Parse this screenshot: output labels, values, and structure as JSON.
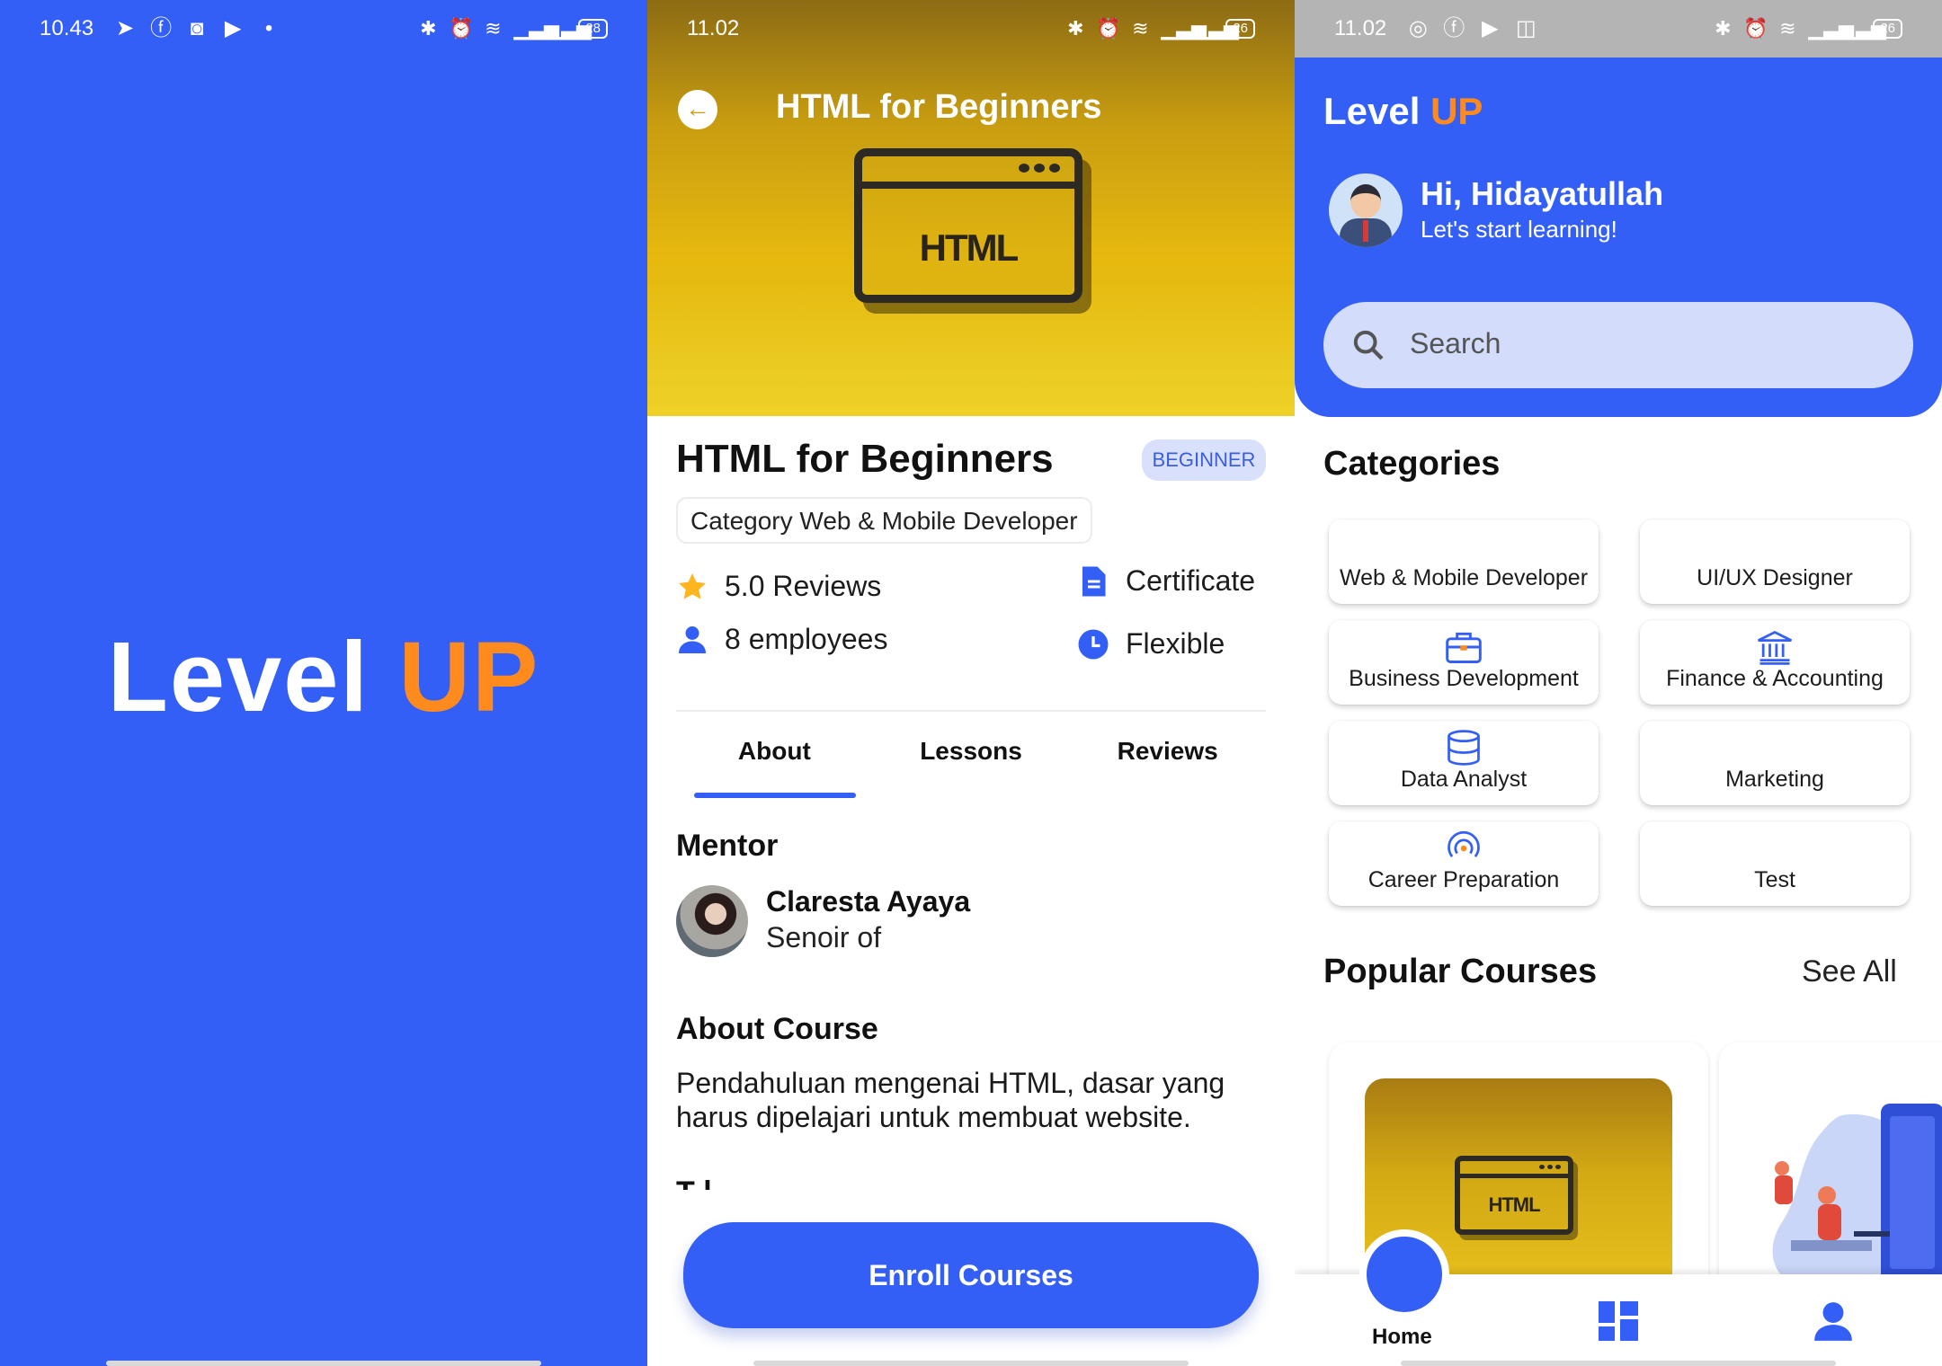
{
  "colors": {
    "primary": "#335ff6",
    "accent": "#ff8a1e",
    "badge_bg": "#d8e0fb",
    "search_bg": "#d3dcfb"
  },
  "splash": {
    "status_time": "10.43",
    "battery": "28",
    "logo_level": "Level",
    "logo_up": "UP"
  },
  "detail": {
    "status_time": "11.02",
    "battery": "26",
    "header_title": "HTML for Beginners",
    "hero_word": "HTML",
    "course_title": "HTML for Beginners",
    "level_badge": "BEGINNER",
    "category": "Category Web & Mobile Developer",
    "reviews": "5.0 Reviews",
    "employees": "8 employees",
    "certificate": "Certificate",
    "schedule": "Flexible",
    "tabs": [
      "About",
      "Lessons",
      "Reviews"
    ],
    "active_tab": "About",
    "mentor_heading": "Mentor",
    "mentor_name": "Claresta Ayaya",
    "mentor_role": "Senoir of",
    "about_heading": "About Course",
    "about_text": "Pendahuluan mengenai HTML, dasar yang harus dipelajari untuk membuat website.",
    "next_heading_partial": "T  l",
    "enroll_button": "Enroll Courses"
  },
  "home": {
    "status_time": "11.02",
    "battery": "26",
    "brand_level": "Level",
    "brand_up": "UP",
    "greeting": "Hi, Hidayatullah",
    "greeting_sub": "Let's start learning!",
    "search_placeholder": "Search",
    "categories_heading": "Categories",
    "categories": [
      {
        "label": "Web & Mobile Developer",
        "icon": "none"
      },
      {
        "label": "UI/UX Designer",
        "icon": "none"
      },
      {
        "label": "Business Development",
        "icon": "briefcase-icon"
      },
      {
        "label": "Finance & Accounting",
        "icon": "bank-icon"
      },
      {
        "label": "Data Analyst",
        "icon": "database-icon"
      },
      {
        "label": "Marketing",
        "icon": "none"
      },
      {
        "label": "Career Preparation",
        "icon": "target-icon"
      },
      {
        "label": "Test",
        "icon": "none"
      }
    ],
    "popular_heading": "Popular Courses",
    "see_all": "See All",
    "card_word": "HTML",
    "nav": {
      "home_label": "Home"
    }
  }
}
